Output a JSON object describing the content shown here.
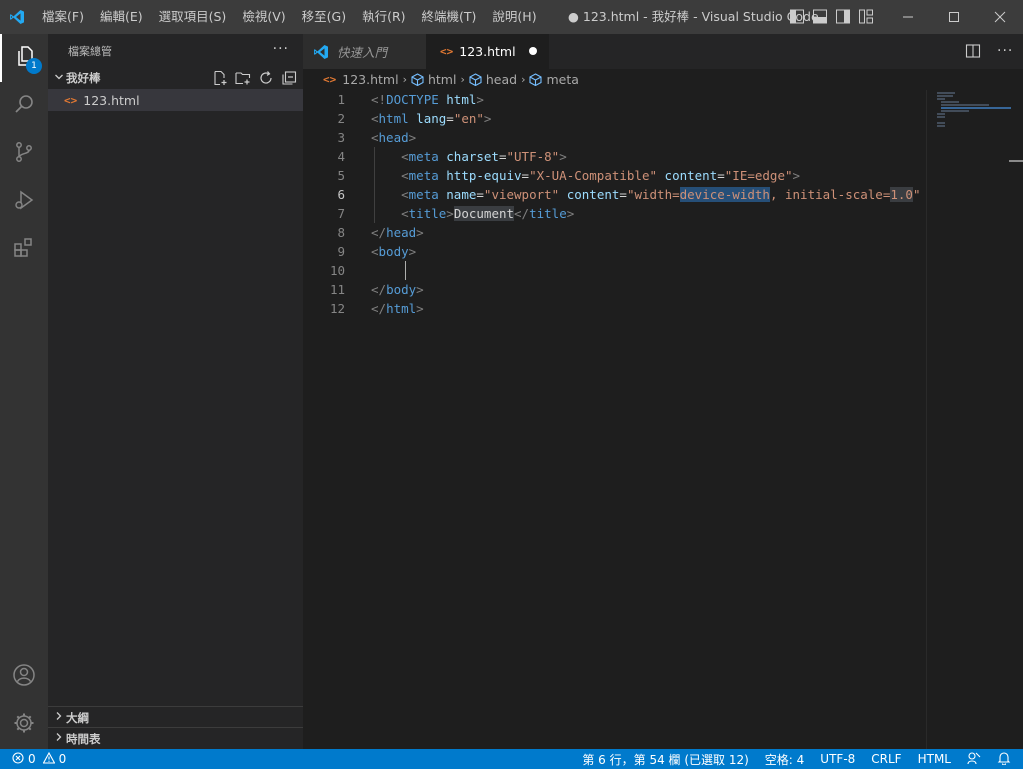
{
  "titlebar": {
    "menu": [
      "檔案(F)",
      "編輯(E)",
      "選取項目(S)",
      "檢視(V)",
      "移至(G)",
      "執行(R)",
      "終端機(T)",
      "說明(H)"
    ],
    "window_title": "● 123.html - 我好棒 - Visual Studio Code"
  },
  "activitybar": {
    "explorer_badge": "1"
  },
  "sidebar": {
    "title": "檔案總管",
    "folder_name": "我好棒",
    "file_name": "123.html",
    "outline_label": "大綱",
    "timeline_label": "時間表"
  },
  "tabs": {
    "tab1_label": "快速入門",
    "tab2_label": "123.html"
  },
  "breadcrumbs": {
    "file": "123.html",
    "crumb1": "html",
    "crumb2": "head",
    "crumb3": "meta"
  },
  "editor": {
    "line_numbers": [
      "1",
      "2",
      "3",
      "4",
      "5",
      "6",
      "7",
      "8",
      "9",
      "10",
      "11",
      "12"
    ],
    "current_line": 6
  },
  "statusbar": {
    "errors": "0",
    "warnings": "0",
    "position": "第 6 行，第 54 欄 (已選取 12)",
    "spaces": "空格: 4",
    "encoding": "UTF-8",
    "eol": "CRLF",
    "language": "HTML"
  },
  "colors": {
    "accent": "#007acc",
    "titlebar": "#3c3c3c",
    "activitybar": "#333333",
    "sidebar": "#252526",
    "editor": "#1e1e1e"
  }
}
